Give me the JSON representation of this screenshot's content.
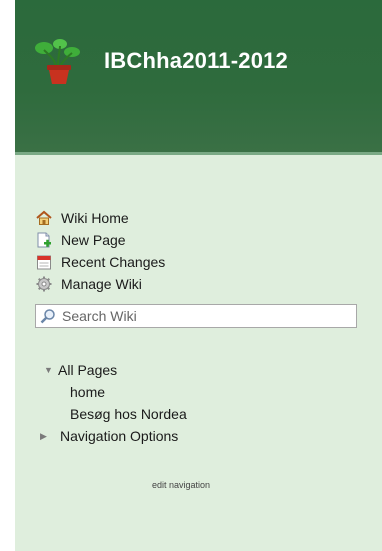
{
  "header": {
    "title": "IBChha2011-2012",
    "logo_icon": "potted-plant-icon"
  },
  "nav": {
    "items": [
      {
        "label": "Wiki Home",
        "icon": "house-icon"
      },
      {
        "label": "New Page",
        "icon": "new-page-icon"
      },
      {
        "label": "Recent Changes",
        "icon": "calendar-icon"
      },
      {
        "label": "Manage Wiki",
        "icon": "gear-icon"
      }
    ]
  },
  "search": {
    "placeholder": "Search Wiki",
    "icon": "search-icon"
  },
  "tree": {
    "all_pages_label": "All Pages",
    "all_pages_state": "expanded",
    "pages": [
      "home",
      "Besøg hos Nordea"
    ],
    "navigation_options_label": "Navigation Options",
    "navigation_options_state": "collapsed",
    "edit_navigation_label": "edit navigation"
  },
  "colors": {
    "header_bg": "#2b6a3c",
    "panel_bg": "#dfeedd"
  }
}
